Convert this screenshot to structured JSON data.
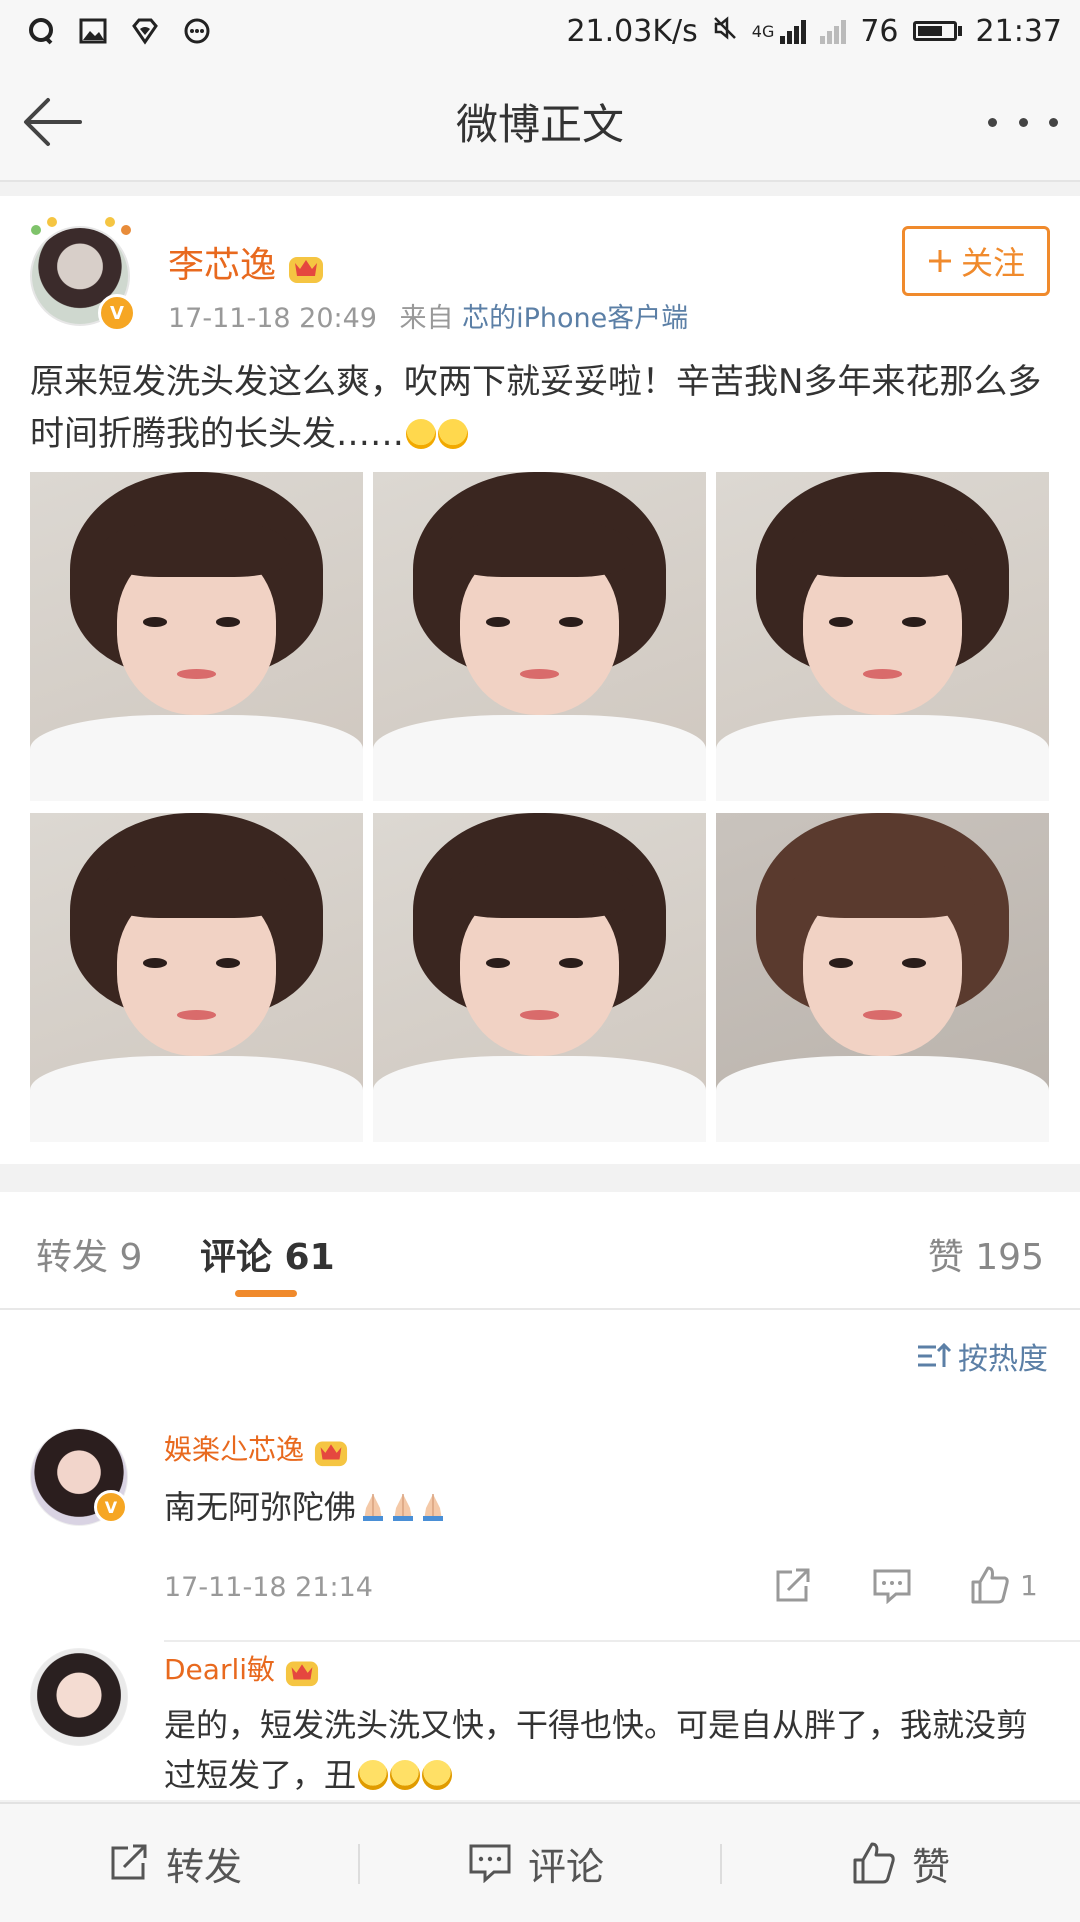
{
  "status_bar": {
    "net_speed": "21.03K/s",
    "network": "4G",
    "battery": "76",
    "battery_fraction": 0.76,
    "time": "21:37"
  },
  "nav": {
    "title": "微博正文"
  },
  "post": {
    "author": "李芯逸",
    "time": "17-11-18 20:49",
    "source_prefix": "来自",
    "source": "芯的iPhone客户端",
    "follow_label": "关注",
    "text": "原来短发洗头发这么爽，吹两下就妥妥啦！辛苦我N多年来花那么多时间折腾我的长头发……"
  },
  "tabs": {
    "repost": "转发 9",
    "comment": "评论 61",
    "like": "赞 195"
  },
  "sort_label": "按热度",
  "comments": [
    {
      "name": "娛楽尐芯逸",
      "text": "南无阿弥陀佛",
      "time": "17-11-18 21:14",
      "likes": "1"
    },
    {
      "name": "Dearli敏",
      "text": "是的，短发洗头洗又快，干得也快。可是自从胖了，我就没剪过短发了，丑"
    }
  ],
  "bottom_bar": {
    "repost": "转发",
    "comment": "评论",
    "like": "赞"
  },
  "colors": {
    "accent_orange": "#f08a2c",
    "name_orange": "#e8691e",
    "link_blue": "#5b7fa6"
  }
}
